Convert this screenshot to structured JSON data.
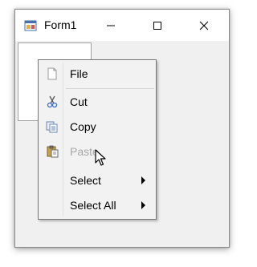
{
  "window": {
    "title": "Form1",
    "controls": {
      "minimize": "minimize",
      "maximize": "maximize",
      "close": "close"
    }
  },
  "context_menu": {
    "items": [
      {
        "label": "File",
        "icon": "file-icon",
        "enabled": true
      },
      {
        "label": "Cut",
        "icon": "cut-icon",
        "enabled": true
      },
      {
        "label": "Copy",
        "icon": "copy-icon",
        "enabled": true
      },
      {
        "label": "Paste",
        "icon": "paste-icon",
        "enabled": false
      },
      {
        "label": "Select",
        "submenu": true,
        "enabled": true
      },
      {
        "label": "Select All",
        "submenu": true,
        "enabled": true
      }
    ]
  }
}
